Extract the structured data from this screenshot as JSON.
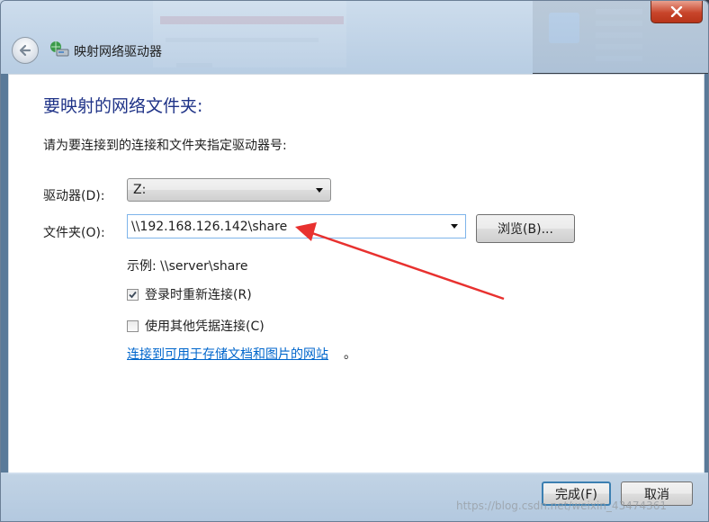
{
  "window": {
    "title": "映射网络驱动器"
  },
  "content": {
    "heading": "要映射的网络文件夹:",
    "instruction": "请为要连接到的连接和文件夹指定驱动器号:",
    "drive_label": "驱动器(D):",
    "drive_value": "Z:",
    "folder_label": "文件夹(O):",
    "folder_value": "\\\\192.168.126.142\\share",
    "browse_label": "浏览(B)...",
    "example_text": "示例: \\\\server\\share",
    "reconnect_label": "登录时重新连接(R)",
    "reconnect_checked": true,
    "other_credentials_label": "使用其他凭据连接(C)",
    "other_credentials_checked": false,
    "link_text": "连接到可用于存储文档和图片的网站",
    "link_suffix": "。"
  },
  "footer": {
    "finish_label": "完成(F)",
    "cancel_label": "取消",
    "watermark": "https://blog.csdn.net/weixin_43474361"
  },
  "colors": {
    "heading": "#1e3287",
    "link": "#0066cc",
    "annotation_arrow": "#e8312f",
    "close_button": "#c8452b"
  }
}
